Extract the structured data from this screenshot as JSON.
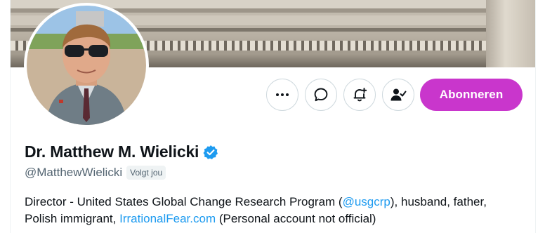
{
  "profile": {
    "display_name": "Dr. Matthew M. Wielicki",
    "handle": "@MatthewWielicki",
    "follows_you_badge": "Volgt jou",
    "verified": true
  },
  "actions": {
    "subscribe_label": "Abonneren",
    "icons": [
      "more-icon",
      "message-icon",
      "notify-icon",
      "following-icon"
    ]
  },
  "bio": {
    "part1": "Director - United States Global Change Research Program (",
    "mention": "@usgcrp",
    "part2": "), husband, father, Polish immigrant, ",
    "link": "IrrationalFear.com",
    "part3": " (Personal account not official)"
  },
  "colors": {
    "subscribe_bg": "#c936cc",
    "link": "#1d9bf0",
    "verified": "#1d9bf0",
    "secondary_text": "#536471"
  }
}
